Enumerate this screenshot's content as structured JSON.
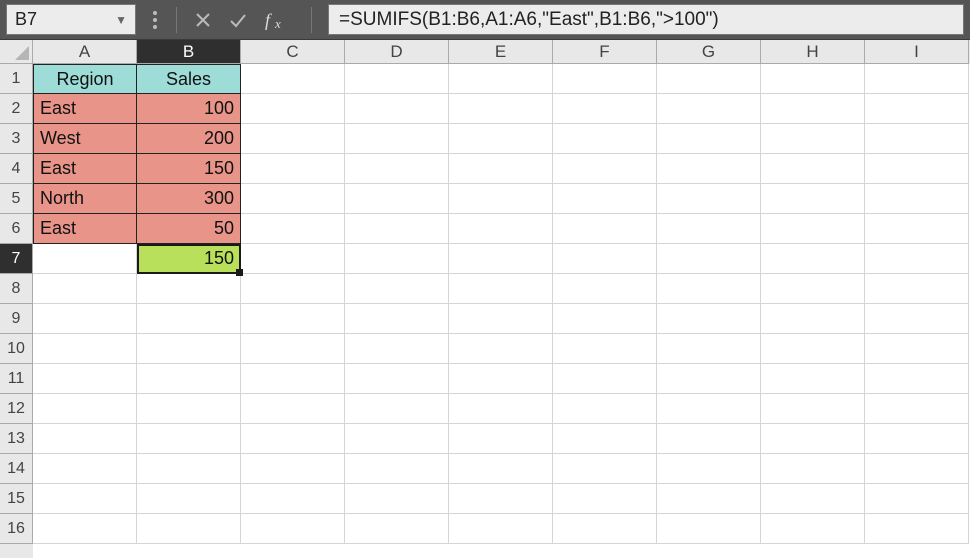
{
  "name_box": {
    "value": "B7"
  },
  "formula_bar": {
    "formula": "=SUMIFS(B1:B6,A1:A6,\"East\",B1:B6,\">100\")"
  },
  "columns": [
    "A",
    "B",
    "C",
    "D",
    "E",
    "F",
    "G",
    "H",
    "I"
  ],
  "rows": [
    "1",
    "2",
    "3",
    "4",
    "5",
    "6",
    "7",
    "8",
    "9",
    "10",
    "11",
    "12",
    "13",
    "14",
    "15",
    "16"
  ],
  "active_col_index": 1,
  "active_row_index": 6,
  "headers": {
    "region": "Region",
    "sales": "Sales"
  },
  "data": [
    {
      "region": "East",
      "sales": "100"
    },
    {
      "region": "West",
      "sales": "200"
    },
    {
      "region": "East",
      "sales": "150"
    },
    {
      "region": "North",
      "sales": "300"
    },
    {
      "region": "East",
      "sales": "50"
    }
  ],
  "result": {
    "value": "150"
  },
  "colors": {
    "header_fill": "#9edcd8",
    "data_fill": "#e99489",
    "result_fill": "#b8e05a",
    "app_bg": "#555"
  }
}
